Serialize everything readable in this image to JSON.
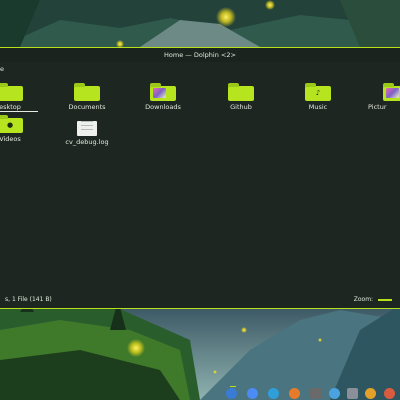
{
  "window": {
    "title": "Home — Dolphin <2>",
    "location": "e"
  },
  "items": [
    {
      "label": "esktop",
      "kind": "folder",
      "glyph": "",
      "selected": true
    },
    {
      "label": "Documents",
      "kind": "folder",
      "glyph": ""
    },
    {
      "label": "Downloads",
      "kind": "folder-thumb",
      "glyph": ""
    },
    {
      "label": "Github",
      "kind": "folder",
      "glyph": ""
    },
    {
      "label": "Music",
      "kind": "folder",
      "glyph": "♪"
    },
    {
      "label": "Pictur",
      "kind": "folder-thumb",
      "glyph": ""
    },
    {
      "label": "Videos",
      "kind": "folder",
      "glyph": "●"
    },
    {
      "label": "cv_debug.log",
      "kind": "file",
      "glyph": ""
    }
  ],
  "status": {
    "text": "s, 1 File (141 B)",
    "zoom_label": "Zoom:"
  },
  "colors": {
    "accent": "#b8e01a",
    "window_bg": "#1d2620",
    "text": "#e6eadf"
  },
  "taskbar": {
    "icons": [
      "browser-icon",
      "chrome-icon",
      "edge-icon",
      "firefox-icon",
      "files-icon",
      "terminal-icon",
      "store-icon",
      "settings-icon",
      "photos-icon",
      "app-icon"
    ]
  }
}
